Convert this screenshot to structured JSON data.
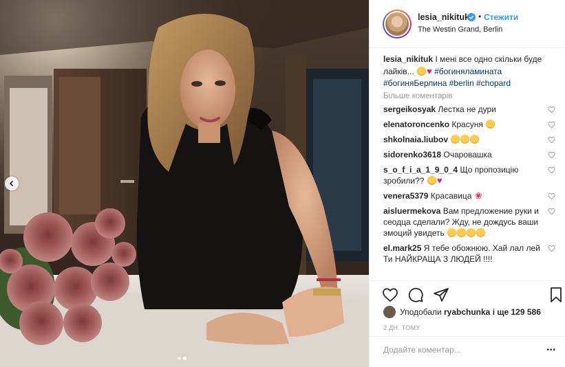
{
  "post": {
    "username": "lesia_nikituk",
    "follow_label": "Стежити",
    "separator": "•",
    "location": "The Westin Grand, Berlin",
    "caption_text": "І мені все одно скільки буде лайків...",
    "hashtags": [
      "#богиняламината",
      "#богиняБерлина",
      "#berlin",
      "#chopard"
    ],
    "more_comments": "Більше коментарів",
    "likes_by": "Уподобали",
    "likes_user": "ryabchunka",
    "likes_rest": "і ще 129 586",
    "time": "2 ДН. ТОМУ",
    "comment_placeholder": "Додайте коментар...",
    "post_button": "•••",
    "carousel": {
      "slides": 2,
      "active": 2
    }
  },
  "comments": [
    {
      "user": "sergeikosyak",
      "text": "Лестка не дури",
      "emoji": []
    },
    {
      "user": "elenatoroncenko",
      "text": "Красуня",
      "emoji": [
        "love"
      ]
    },
    {
      "user": "shkolnaia.liubov",
      "text": "",
      "emoji": [
        "love",
        "love",
        "raised-hands"
      ]
    },
    {
      "user": "sidorenko3618",
      "text": "Очаровашка",
      "emoji": []
    },
    {
      "user": "s_o_f_i_a_1_9_0_4",
      "text": "Що пропозицію зробили??",
      "emoji": [
        "thumbs-up",
        "red-heart"
      ]
    },
    {
      "user": "venera5379",
      "text": "Красавица",
      "emoji": [
        "rose"
      ]
    },
    {
      "user": "aisluermekova",
      "text": "Вам предложение руки и сеодца сделали? Жду, не дождусь ваши эмоций увидеть",
      "emoji": [
        "love",
        "love",
        "love",
        "love"
      ]
    },
    {
      "user": "el.mark25",
      "text": "Я тебе обожнюю. Хай лал лей Ти НАЙКРАЩА З ЛЮДЕЙ !!!!",
      "emoji": []
    }
  ],
  "icons": {
    "verified": "verified-badge-icon",
    "like": "heart-outline-icon",
    "comment": "comment-bubble-icon",
    "share": "paper-plane-icon",
    "save": "bookmark-icon",
    "prev": "chevron-left-icon"
  },
  "colors": {
    "accent": "#3897f0",
    "hashtag": "#003569",
    "muted": "#999999",
    "heart": "#e0245e"
  }
}
